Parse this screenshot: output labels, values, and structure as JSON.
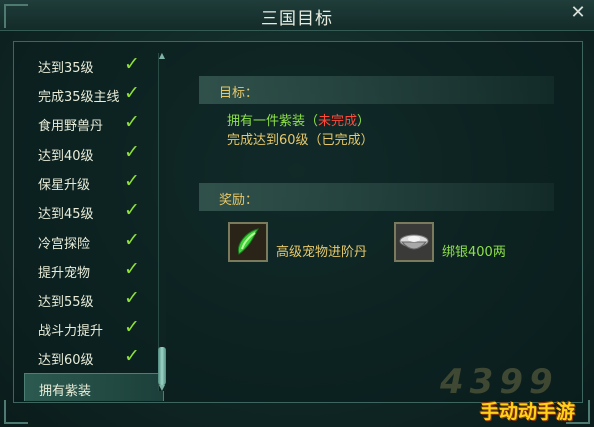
{
  "window": {
    "title": "三国目标",
    "close_glyph": "✕"
  },
  "goal_list": {
    "items": [
      {
        "label": "达到35级",
        "done": true,
        "check": "✓"
      },
      {
        "label": "完成35级主线",
        "done": true,
        "check": "✓"
      },
      {
        "label": "食用野兽丹",
        "done": true,
        "check": "✓"
      },
      {
        "label": "达到40级",
        "done": true,
        "check": "✓"
      },
      {
        "label": "保星升级",
        "done": true,
        "check": "✓"
      },
      {
        "label": "达到45级",
        "done": true,
        "check": "✓"
      },
      {
        "label": "冷宫探险",
        "done": true,
        "check": "✓"
      },
      {
        "label": "提升宠物",
        "done": true,
        "check": "✓"
      },
      {
        "label": "达到55级",
        "done": true,
        "check": "✓"
      },
      {
        "label": "战斗力提升",
        "done": true,
        "check": "✓"
      },
      {
        "label": "达到60级",
        "done": true,
        "check": "✓"
      },
      {
        "label": "拥有紫装",
        "done": false,
        "check": "",
        "selected": true
      }
    ]
  },
  "detail": {
    "goal_heading": "目标：",
    "goals": [
      {
        "text": "拥有一件紫装",
        "open": "（",
        "status": "未完成",
        "close": "）",
        "status_color": "#ff4a3a"
      },
      {
        "text": "完成达到60级",
        "open": "（",
        "status": "已完成",
        "close": "）",
        "status_color": "#e6c86a"
      }
    ],
    "reward_heading": "奖励：",
    "rewards": [
      {
        "name": "高级宠物进阶丹",
        "icon": "green-pill-icon"
      },
      {
        "name": "绑银400两",
        "icon": "silver-ingot-icon"
      }
    ]
  },
  "watermark": {
    "text": "4399",
    "brand": "手动动手游"
  },
  "colors": {
    "accent": "#e6c86a",
    "check": "#8fe03a",
    "incomplete": "#ff4a3a"
  }
}
